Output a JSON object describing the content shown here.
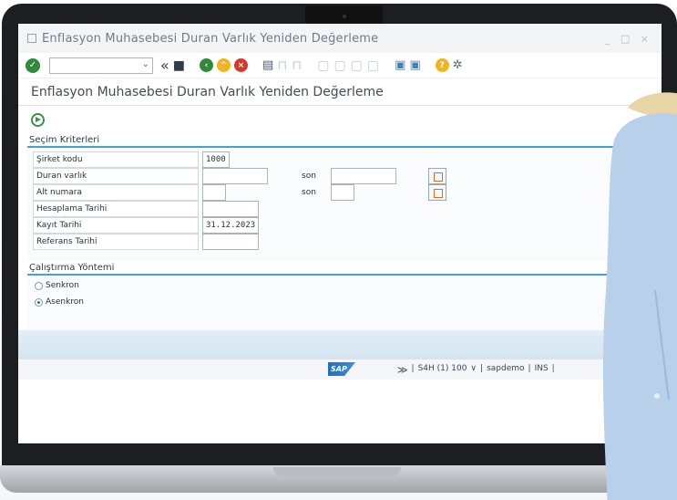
{
  "window": {
    "title": "Enflasyon Muhasebesi Duran Varlık Yeniden Değerleme",
    "controls": "_ □ ×"
  },
  "toolbar": {
    "command_field_value": "",
    "icons": [
      "check-icon",
      "command-field",
      "back-double-icon",
      "save-icon",
      "back-icon",
      "exit-icon",
      "cancel-icon",
      "print-icon",
      "find-icon",
      "find-next-icon",
      "first-page-icon",
      "previous-page-icon",
      "next-page-icon",
      "last-page-icon",
      "new-session-icon",
      "shortcut-icon",
      "help-icon",
      "customize-layout-icon"
    ]
  },
  "header": {
    "title": "Enflasyon Muhasebesi Duran Varlık Yeniden Değerleme"
  },
  "selection": {
    "section_title": "Seçim Kriterleri",
    "son_label": "son",
    "fields": [
      {
        "label": "Şirket kodu",
        "value": "1000"
      },
      {
        "label": "Duran varlık",
        "value": "",
        "to_value": ""
      },
      {
        "label": "Alt numara",
        "value": "",
        "to_value": ""
      },
      {
        "label": "Hesaplama Tarihi",
        "value": ""
      },
      {
        "label": "Kayıt Tarihi",
        "value": "31.12.2023"
      },
      {
        "label": "Referans Tarihi",
        "value": ""
      }
    ]
  },
  "run_mode": {
    "section_title": "Çalıştırma Yöntemi",
    "options": [
      {
        "label": "Senkron",
        "selected": false
      },
      {
        "label": "Asenkron",
        "selected": true
      }
    ]
  },
  "status_bar": {
    "logo_text": "SAP",
    "expand": "≫",
    "system": "S4H (1) 100",
    "dropdown": "∨",
    "user": "sapdemo",
    "mode": "INS"
  },
  "colors": {
    "accent_blue": "#4a9fd5",
    "ok_green": "#2e8b3a",
    "warning_yellow": "#f0b323",
    "cancel_red": "#d33a2c"
  }
}
